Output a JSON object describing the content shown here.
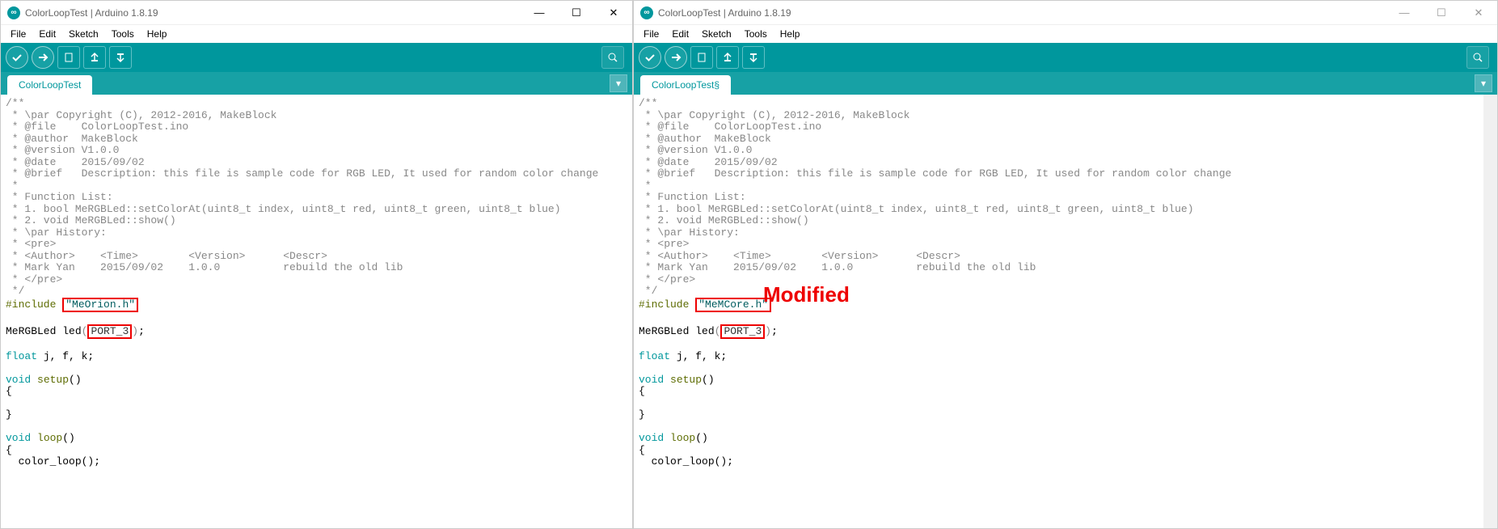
{
  "windows": [
    {
      "title": "ColorLoopTest | Arduino 1.8.19",
      "tab": "ColorLoopTest",
      "controls_faded": false,
      "include_value": "\"MeOrion.h\"",
      "annotation": ""
    },
    {
      "title": "ColorLoopTest | Arduino 1.8.19",
      "tab": "ColorLoopTest§",
      "controls_faded": true,
      "include_value": "\"MeMCore.h\"",
      "annotation": "Modified"
    }
  ],
  "menu": [
    "File",
    "Edit",
    "Sketch",
    "Tools",
    "Help"
  ],
  "code": {
    "header": [
      "/**",
      " * \\par Copyright (C), 2012-2016, MakeBlock",
      " * @file    ColorLoopTest.ino",
      " * @author  MakeBlock",
      " * @version V1.0.0",
      " * @date    2015/09/02",
      " * @brief   Description: this file is sample code for RGB LED, It used for random color change",
      " *",
      " * Function List:",
      " * 1. bool MeRGBLed::setColorAt(uint8_t index, uint8_t red, uint8_t green, uint8_t blue)",
      " * 2. void MeRGBLed::show()",
      " * \\par History:",
      " * <pre>",
      " * <Author>    <Time>        <Version>      <Descr>",
      " * Mark Yan    2015/09/02    1.0.0          rebuild the old lib",
      " * </pre>",
      " */"
    ],
    "include_kw": "#include",
    "decl_type": "MeRGBLed",
    "decl_var": "led",
    "decl_port": "PORT_3",
    "decl_end": ";",
    "float_line_type": "float",
    "float_line_rest": " j, f, k;",
    "void_kw": "void",
    "setup_name": "setup",
    "setup_parens": "()",
    "brace_open": "{",
    "brace_close": "}",
    "loop_name": "loop",
    "loop_body": "  color_loop();"
  }
}
